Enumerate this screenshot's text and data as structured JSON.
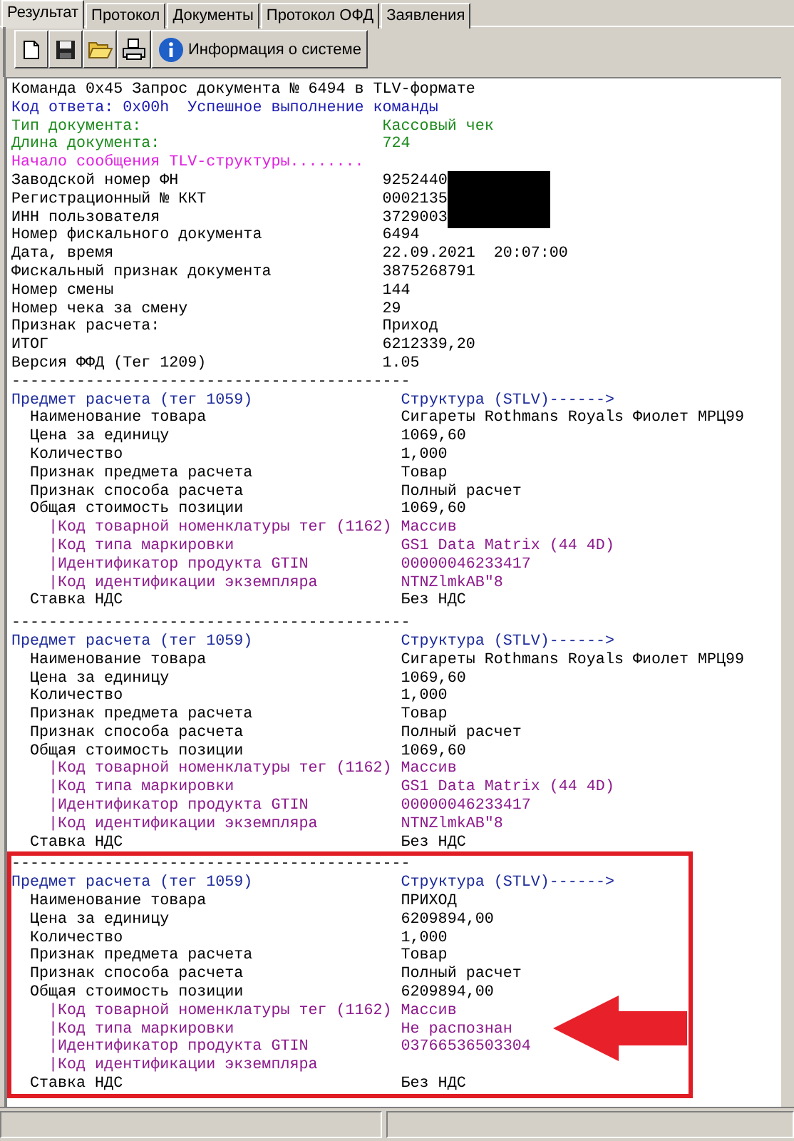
{
  "tabs": [
    {
      "label": "Результат",
      "selected": true
    },
    {
      "label": "Протокол",
      "selected": false
    },
    {
      "label": "Документы",
      "selected": false
    },
    {
      "label": "Протокол ОФД",
      "selected": false
    },
    {
      "label": "Заявления",
      "selected": false
    }
  ],
  "toolbar": [
    {
      "kind": "new"
    },
    {
      "kind": "save"
    },
    {
      "kind": "open"
    },
    {
      "kind": "print"
    },
    {
      "kind": "info",
      "label": "Информация о системе"
    }
  ],
  "log": {
    "command": "Команда 0x45 Запрос документа № 6494 в TLV-формате",
    "response": "Код ответа: 0x00h  Успешное выполнение команды",
    "doc_fields": [
      {
        "label": "Тип документа:",
        "value": "Кассовый чек"
      },
      {
        "label": "Длина документа:",
        "value": "724"
      }
    ],
    "tlv_start": "Начало сообщения TLV-структуры........",
    "fields": [
      {
        "label": "Заводской номер ФН",
        "value": "9252440",
        "redacted": true
      },
      {
        "label": "Регистрационный № ККТ",
        "value": "0002135",
        "redacted": true
      },
      {
        "label": "ИНН пользователя",
        "value": "3729003",
        "redacted": true
      },
      {
        "label": "Номер фискального документа",
        "value": "6494",
        "redacted": false
      },
      {
        "label": "Дата, время",
        "value": "22.09.2021  20:07:00",
        "redacted": false
      },
      {
        "label": "Фискальный признак документа",
        "value": "3875268791",
        "redacted": false
      },
      {
        "label": "Номер смены",
        "value": "144",
        "redacted": false
      },
      {
        "label": "Номер чека за смену",
        "value": "29",
        "redacted": false
      },
      {
        "label": "Признак расчета:",
        "value": "Приход",
        "redacted": false
      },
      {
        "label": "ИТОГ",
        "value": "6212339,20",
        "redacted": false
      },
      {
        "label": "Версия ФФД (Тег 1209)",
        "value": "1.05",
        "redacted": false
      }
    ],
    "sections": [
      {
        "separator": "-------------------------------------------",
        "title": "Предмет расчета (тег 1059)",
        "structure": "Структура (STLV)------>",
        "highlighted": false,
        "fields": [
          {
            "label": "Наименование товара",
            "value": "Сигареты Rothmans Royals Фиолет МРЦ99"
          },
          {
            "label": "Цена за единицу",
            "value": "1069,60"
          },
          {
            "label": "Количество",
            "value": "1,000"
          },
          {
            "label": "Признак предмета расчета",
            "value": "Товар"
          },
          {
            "label": "Признак способа расчета",
            "value": "Полный расчет"
          },
          {
            "label": "Общая стоимость позиции",
            "value": "1069,60",
            "children": [
              {
                "label": "|Код товарной номенклатуры тег (1162)",
                "value": "Массив"
              },
              {
                "label": "|Код типа маркировки",
                "value": "GS1 Data Matrix (44 4D)"
              },
              {
                "label": "|Идентификатор продукта GTIN",
                "value": "00000046233417"
              },
              {
                "label": "|Код идентификации экземпляра",
                "value": "NTNZlmkAB\"8"
              }
            ]
          },
          {
            "label": "Ставка НДС",
            "value": "Без НДС"
          }
        ]
      },
      {
        "separator": "-------------------------------------------",
        "title": "Предмет расчета (тег 1059)",
        "structure": "Структура (STLV)------>",
        "highlighted": false,
        "fields": [
          {
            "label": "Наименование товара",
            "value": "Сигареты Rothmans Royals Фиолет МРЦ99"
          },
          {
            "label": "Цена за единицу",
            "value": "1069,60"
          },
          {
            "label": "Количество",
            "value": "1,000"
          },
          {
            "label": "Признак предмета расчета",
            "value": "Товар"
          },
          {
            "label": "Признак способа расчета",
            "value": "Полный расчет"
          },
          {
            "label": "Общая стоимость позиции",
            "value": "1069,60",
            "children": [
              {
                "label": "|Код товарной номенклатуры тег (1162)",
                "value": "Массив"
              },
              {
                "label": "|Код типа маркировки",
                "value": "GS1 Data Matrix (44 4D)"
              },
              {
                "label": "|Идентификатор продукта GTIN",
                "value": "00000046233417"
              },
              {
                "label": "|Код идентификации экземпляра",
                "value": "NTNZlmkAB\"8"
              }
            ]
          },
          {
            "label": "Ставка НДС",
            "value": "Без НДС"
          }
        ]
      },
      {
        "separator": "-------------------------------------------",
        "title": "Предмет расчета (тег 1059)",
        "structure": "Структура (STLV)------>",
        "highlighted": true,
        "fields": [
          {
            "label": "Наименование товара",
            "value": "ПРИХОД"
          },
          {
            "label": "Цена за единицу",
            "value": "6209894,00"
          },
          {
            "label": "Количество",
            "value": "1,000"
          },
          {
            "label": "Признак предмета расчета",
            "value": "Товар"
          },
          {
            "label": "Признак способа расчета",
            "value": "Полный расчет"
          },
          {
            "label": "Общая стоимость позиции",
            "value": "6209894,00",
            "children": [
              {
                "label": "|Код товарной номенклатуры тег (1162)",
                "value": "Массив"
              },
              {
                "label": "|Код типа маркировки",
                "value": "Не распознан"
              },
              {
                "label": "|Идентификатор продукта GTIN",
                "value": "03766536503304"
              },
              {
                "label": "|Код идентификации экземпляра"
              }
            ]
          },
          {
            "label": "Ставка НДС",
            "value": "Без НДС"
          }
        ]
      }
    ]
  }
}
